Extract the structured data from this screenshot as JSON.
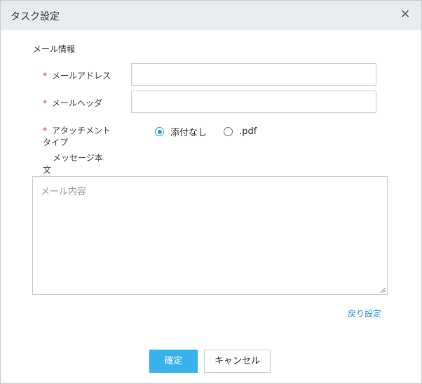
{
  "dialog": {
    "title": "タスク設定",
    "close_glyph": "×"
  },
  "section": {
    "title": "メール情報"
  },
  "fields": {
    "email_address": {
      "required_mark": "*",
      "label": "メールアドレス",
      "value": ""
    },
    "email_header": {
      "required_mark": "*",
      "label": "メールヘッダ",
      "value": ""
    },
    "attachment_type": {
      "required_mark": "*",
      "label_line1": "アタッチメント",
      "label_line2": "タイプ",
      "options": [
        {
          "label": "添付なし",
          "checked": true
        },
        {
          "label": ".pdf",
          "checked": false
        }
      ]
    },
    "message_body": {
      "label_line1": "メッセージ本",
      "label_line2": "文",
      "placeholder": "メール内容"
    }
  },
  "links": {
    "back_settings": "戻り設定"
  },
  "buttons": {
    "confirm": "確定",
    "cancel": "キャンセル"
  },
  "colors": {
    "accent": "#38b1ec",
    "required": "#e53935",
    "link": "#2b8fd6",
    "titlebar_bg": "#e8ebef"
  }
}
